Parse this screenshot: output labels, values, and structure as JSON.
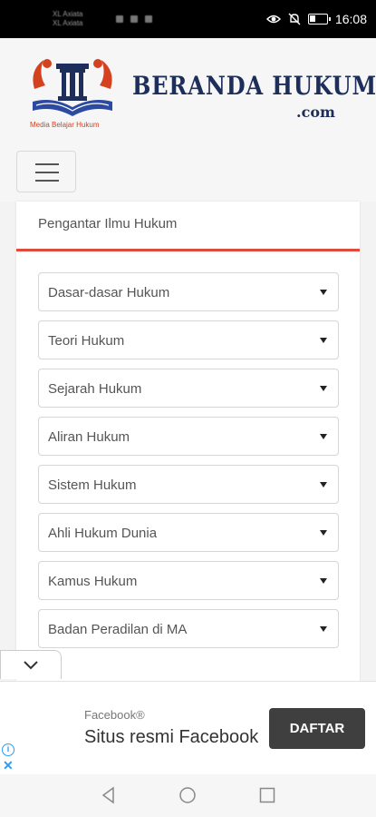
{
  "status_bar": {
    "carrier_line1": "XL Axiata",
    "carrier_line2": "XL Axiata",
    "time": "16:08"
  },
  "header": {
    "logo_tagline": "Media Belajar Hukum",
    "brand_title": "BERANDA HUKUM",
    "brand_domain": ".com",
    "menu_icon": "hamburger-icon"
  },
  "card": {
    "title": "Pengantar Ilmu Hukum",
    "accent_color": "#e04a3a",
    "selects": [
      {
        "label": "Dasar-dasar Hukum"
      },
      {
        "label": "Teori Hukum"
      },
      {
        "label": "Sejarah Hukum"
      },
      {
        "label": "Aliran Hukum"
      },
      {
        "label": "Sistem Hukum"
      },
      {
        "label": "Ahli Hukum Dunia"
      },
      {
        "label": "Kamus Hukum"
      },
      {
        "label": "Badan Peradilan di MA"
      }
    ]
  },
  "ad": {
    "source": "Facebook®",
    "headline": "Situs resmi Facebook",
    "cta": "DAFTAR"
  },
  "colors": {
    "brand_navy": "#1d2e5a",
    "brand_orange": "#d4411f",
    "ad_info_blue": "#2a9df4"
  }
}
